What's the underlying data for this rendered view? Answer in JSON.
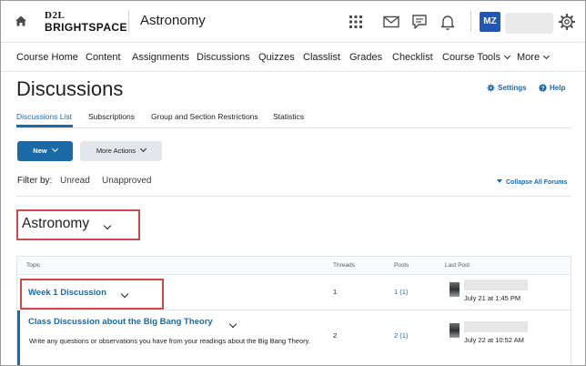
{
  "header": {
    "logo_top": "D2L",
    "logo_bottom": "BRIGHTSPACE",
    "course_title": "Astronomy",
    "user_initials": "MZ"
  },
  "icons": {
    "home": "home-icon",
    "grid": "course-selector-grid-icon",
    "mail": "mail-icon",
    "chat": "chat-bubble-icon",
    "bell": "notification-bell-icon",
    "gear": "gear-icon"
  },
  "nav": [
    {
      "label": "Course Home"
    },
    {
      "label": "Content"
    },
    {
      "label": "Assignments"
    },
    {
      "label": "Discussions"
    },
    {
      "label": "Quizzes"
    },
    {
      "label": "Classlist"
    },
    {
      "label": "Grades"
    },
    {
      "label": "Checklist"
    },
    {
      "label": "Course Tools",
      "dropdown": true
    },
    {
      "label": "More",
      "dropdown": true
    }
  ],
  "page": {
    "title": "Discussions",
    "settings_label": "Settings",
    "help_label": "Help"
  },
  "tabs": [
    {
      "label": "Discussions List",
      "active": true
    },
    {
      "label": "Subscriptions"
    },
    {
      "label": "Group and Section Restrictions"
    },
    {
      "label": "Statistics"
    }
  ],
  "toolbar": {
    "new_label": "New",
    "more_actions_label": "More Actions"
  },
  "filter": {
    "label": "Filter by:",
    "unread": "Unread",
    "unapproved": "Unapproved",
    "collapse_all": "Collapse All Forums"
  },
  "forum": {
    "title": "Astronomy"
  },
  "table": {
    "headers": {
      "topic": "Topic",
      "threads": "Threads",
      "posts": "Posts",
      "last_post": "Last Post"
    },
    "rows": [
      {
        "topic": "Week 1 Discussion",
        "description": "",
        "threads": "1",
        "posts": "1",
        "posts_unread": "(1)",
        "last_post_date": "July 21 at 1:45 PM"
      },
      {
        "topic": "Class Discussion about the Big Bang Theory",
        "description": "Write any questions or observations you have from your readings about the Big Bang Theory.",
        "threads": "2",
        "posts": "2",
        "posts_unread": "(1)",
        "last_post_date": "July 22 at 10:52 AM"
      }
    ]
  },
  "colors": {
    "accent": "#1a6aa8",
    "highlight_border": "#d04a4a",
    "avatar_bg": "#1f56b8"
  }
}
